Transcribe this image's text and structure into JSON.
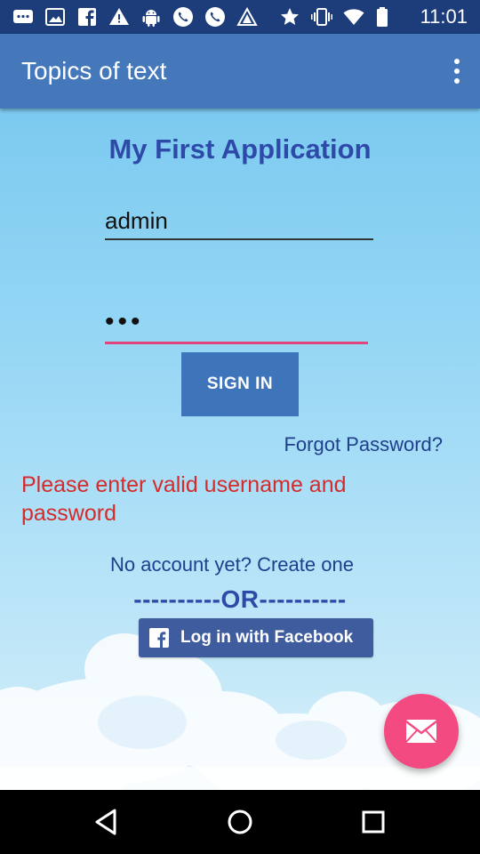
{
  "status_bar": {
    "time": "11:01",
    "icons": [
      "messages-icon",
      "image-icon",
      "facebook-icon",
      "warning-icon",
      "android-icon",
      "phone-icon",
      "phone-icon",
      "triangle-icon",
      "star-icon",
      "vibrate-icon",
      "wifi-icon",
      "battery-icon"
    ]
  },
  "app_bar": {
    "title": "Topics of text",
    "menu_icon": "more-vert-icon"
  },
  "login": {
    "heading": "My First Application",
    "username_value": "admin",
    "password_value": "•••",
    "sign_in_label": "SIGN IN",
    "forgot_password_label": "Forgot Password?",
    "error_message": "Please enter valid username and password",
    "create_account_label": "No account yet? Create one",
    "or_divider": "----------OR----------",
    "facebook_label": "Log in with Facebook"
  },
  "fab": {
    "icon": "mail-icon"
  },
  "nav_bar": {
    "icons": [
      "back-icon",
      "home-icon",
      "recents-icon"
    ]
  },
  "colors": {
    "status_bar": "#1c3d7a",
    "app_bar": "#4478bb",
    "heading": "#2e4aa8",
    "error": "#d42b2b",
    "password_underline": "#e0457b",
    "sign_in_button": "#3e74b9",
    "facebook_button": "#3f5c9e",
    "fab": "#f44a82"
  }
}
